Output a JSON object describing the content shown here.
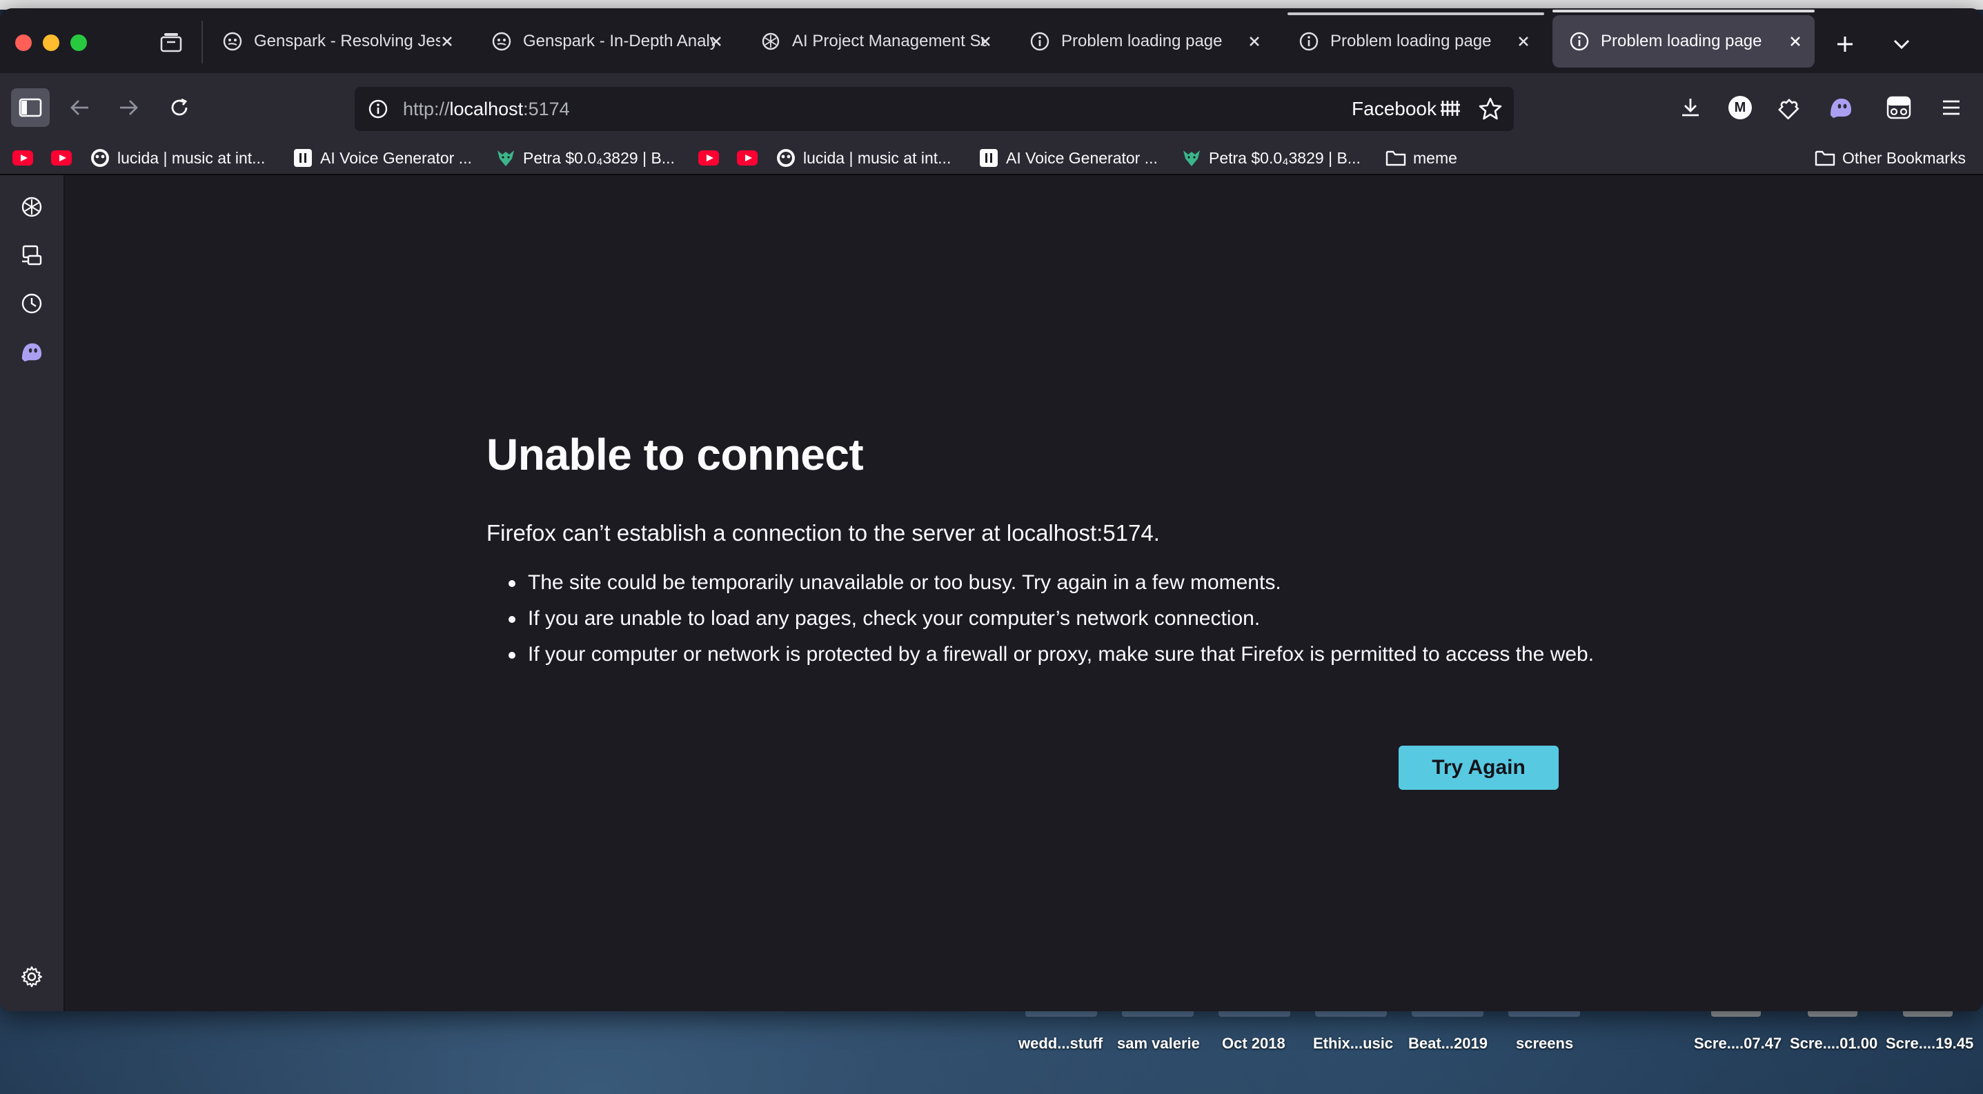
{
  "browser": {
    "tabs": [
      {
        "title": "Genspark - Resolving Jest",
        "icon": "genspark-icon",
        "active": false
      },
      {
        "title": "Genspark - In-Depth Analy",
        "icon": "genspark-icon",
        "active": false
      },
      {
        "title": "AI Project Management Su",
        "icon": "openai-icon",
        "active": false
      },
      {
        "title": "Problem loading page",
        "icon": "info-icon",
        "active": false
      },
      {
        "title": "Problem loading page",
        "icon": "info-icon",
        "active": false
      },
      {
        "title": "Problem loading page",
        "icon": "info-icon",
        "active": true
      }
    ],
    "url_scheme": "http://",
    "url_host": "localhost",
    "url_port": ":5174",
    "urlbar_extension_label": "Facebook"
  },
  "bookmarks": [
    {
      "label": "",
      "icon": "youtube-icon"
    },
    {
      "label": "",
      "icon": "youtube-icon"
    },
    {
      "label": "lucida | music at int...",
      "icon": "lucida-icon"
    },
    {
      "label": "AI Voice Generator ...",
      "icon": "pause-logo-icon"
    },
    {
      "label": "Petra $0.0₄3829 | B...",
      "icon": "petra-icon"
    },
    {
      "label": "",
      "icon": "youtube-icon"
    },
    {
      "label": "",
      "icon": "youtube-icon"
    },
    {
      "label": "lucida | music at int...",
      "icon": "lucida-icon"
    },
    {
      "label": "AI Voice Generator ...",
      "icon": "pause-logo-icon"
    },
    {
      "label": "Petra $0.0₄3829 | B...",
      "icon": "petra-icon"
    },
    {
      "label": "meme",
      "icon": "folder-icon"
    }
  ],
  "other_bookmarks": "Other Bookmarks",
  "error": {
    "title": "Unable to connect",
    "subtitle": "Firefox can’t establish a connection to the server at localhost:5174.",
    "items": [
      "The site could be temporarily unavailable or too busy. Try again in a few moments.",
      "If you are unable to load any pages, check your computer’s network connection.",
      "If your computer or network is protected by a firewall or proxy, make sure that Firefox is permitted to access the web."
    ],
    "button": "Try Again"
  },
  "desktop_items": [
    "wedd...stuff",
    "sam valerie",
    "Oct 2018",
    "Ethix...usic",
    "Beat...2019",
    "screens",
    "Scre....07.47",
    "Scre....01.00",
    "Scre....19.45"
  ],
  "colors": {
    "accent_button": "#57cae2",
    "content_bg": "#1c1b22",
    "toolbar_bg": "#2b2a33"
  }
}
